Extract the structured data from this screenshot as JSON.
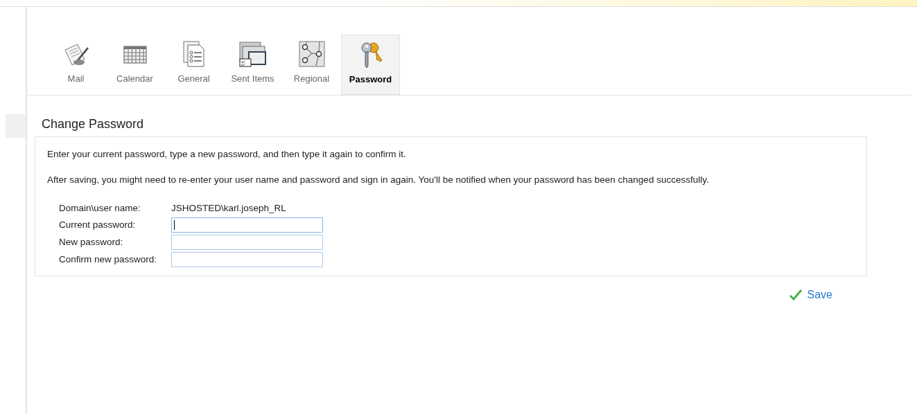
{
  "tabs": [
    {
      "label": "Mail",
      "selected": false
    },
    {
      "label": "Calendar",
      "selected": false
    },
    {
      "label": "General",
      "selected": false
    },
    {
      "label": "Sent Items",
      "selected": false
    },
    {
      "label": "Regional",
      "selected": false
    },
    {
      "label": "Password",
      "selected": true
    }
  ],
  "section": {
    "title": "Change Password",
    "paragraphs": [
      "Enter your current password, type a new password, and then type it again to confirm it.",
      "After saving, you might need to re-enter your user name and password and sign in again. You'll be notified when your password has been changed successfully."
    ],
    "user": {
      "label": "Domain\\user name:",
      "value": "JSHOSTED\\karl.joseph_RL"
    },
    "fields": [
      {
        "label": "Current password:",
        "focused": true
      },
      {
        "label": "New password:",
        "focused": false
      },
      {
        "label": "Confirm new password:",
        "focused": false
      }
    ]
  },
  "save_button": "Save"
}
